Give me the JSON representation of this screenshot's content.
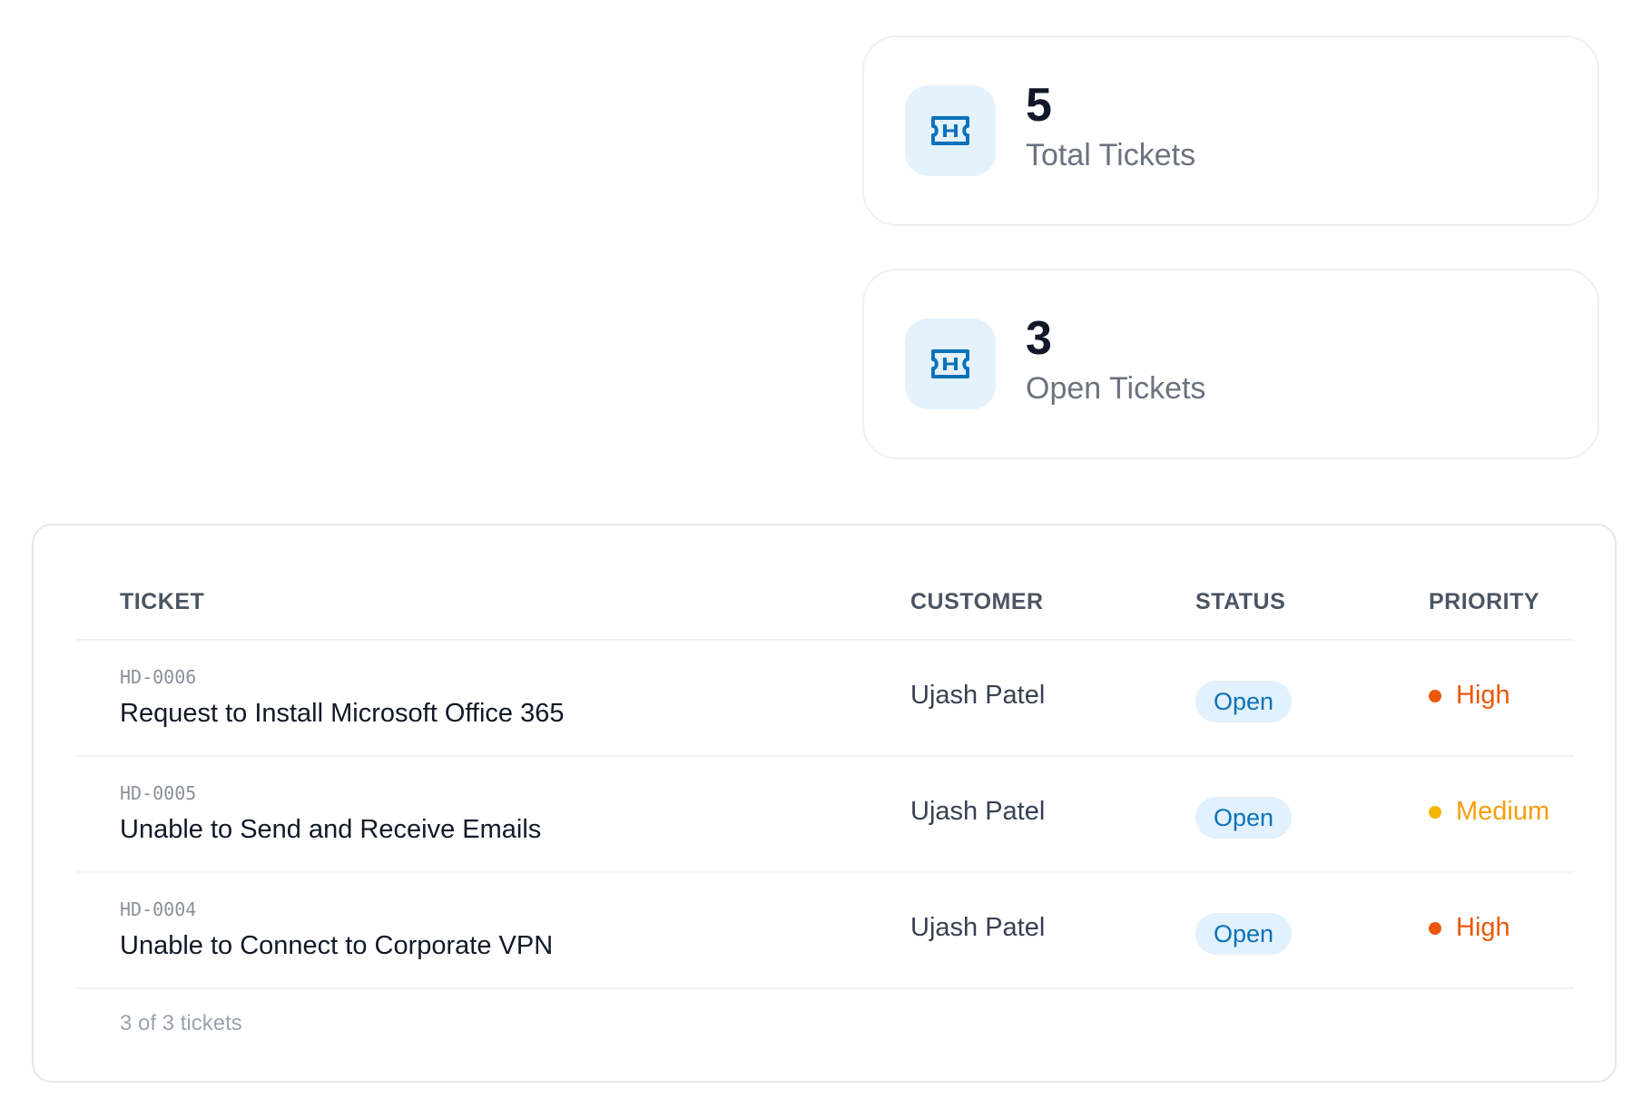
{
  "stats": [
    {
      "value": "5",
      "label": "Total Tickets",
      "icon": "ticket-icon"
    },
    {
      "value": "3",
      "label": "Open Tickets",
      "icon": "ticket-icon"
    }
  ],
  "table": {
    "headers": {
      "ticket": "TICKET",
      "customer": "CUSTOMER",
      "status": "STATUS",
      "priority": "PRIORITY"
    },
    "rows": [
      {
        "id": "HD-0006",
        "title": "Request to Install Microsoft Office 365",
        "customer": "Ujash Patel",
        "status": "Open",
        "priority": "High"
      },
      {
        "id": "HD-0005",
        "title": "Unable to Send and Receive Emails",
        "customer": "Ujash Patel",
        "status": "Open",
        "priority": "Medium"
      },
      {
        "id": "HD-0004",
        "title": "Unable to Connect to Corporate VPN",
        "customer": "Ujash Patel",
        "status": "Open",
        "priority": "High"
      }
    ],
    "footer": "3 of 3 tickets"
  },
  "colors": {
    "accent": "#0b72b9",
    "icon_bg": "#e3f2fd",
    "priority_high": "#ea580c",
    "priority_medium": "#f59e0b"
  }
}
